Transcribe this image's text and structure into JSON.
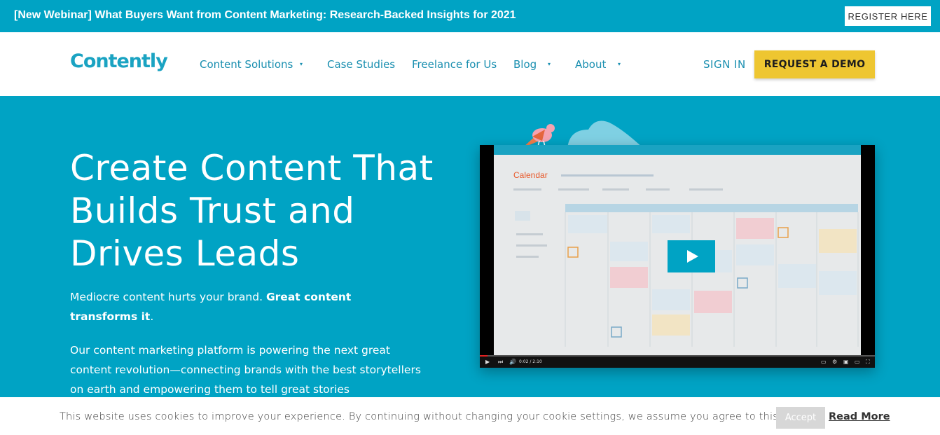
{
  "banner": {
    "text": "[New Webinar] What Buyers Want from Content Marketing: Research-Backed Insights for 2021",
    "button_label": "REGISTER HERE"
  },
  "nav": {
    "logo": "Contently",
    "items": [
      {
        "label": "Content Solutions",
        "has_dropdown": true
      },
      {
        "label": "Case Studies",
        "has_dropdown": false
      },
      {
        "label": "Freelance for Us",
        "has_dropdown": false
      },
      {
        "label": "Blog",
        "has_dropdown": true
      },
      {
        "label": "About",
        "has_dropdown": true
      }
    ],
    "sign_in": "SIGN IN",
    "demo_button": "REQUEST A DEMO",
    "caret_icon": "▾"
  },
  "hero": {
    "title": "Create Content That Builds Trust and Drives Leads",
    "p1_plain": "Mediocre content hurts your brand. ",
    "p1_bold": "Great content transforms it",
    "p1_end": ".",
    "p2": "Our content marketing platform is powering the next great content revolution—connecting brands with the best storytellers on earth and empowering them to tell great stories",
    "video": {
      "calendar_title": "Calendar",
      "time": "0:02 / 2:10",
      "progress": 0.02
    }
  },
  "cookie": {
    "text": "This website uses cookies to improve your experience. By continuing without changing your cookie settings, we assume you agree to this.",
    "accept": "Accept",
    "read_more": "Read More"
  },
  "colors": {
    "brand": "#00a3c4",
    "demo_button": "#eec631",
    "nav_text": "#1a8fb0"
  }
}
